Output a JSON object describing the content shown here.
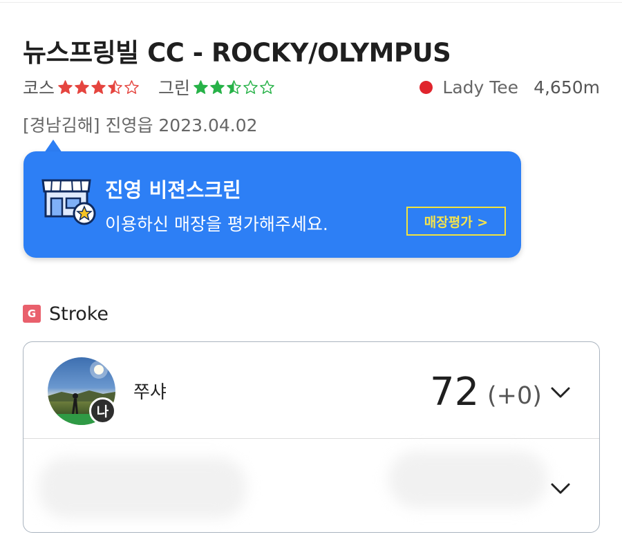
{
  "header": {
    "title": "뉴스프링빌 CC - ROCKY/OLYMPUS",
    "course_label": "코스",
    "course_rating": 3.5,
    "green_label": "그린",
    "green_rating": 2.5,
    "star_colors": {
      "course": "#e5453f",
      "green": "#27b248"
    },
    "tee_color": "#e0242c",
    "tee_name": "Lady Tee",
    "tee_distance": "4,650m",
    "location_date": "[경남김해] 진영읍 2023.04.02"
  },
  "banner": {
    "icon": "store-icon",
    "title": "진영 비젼스크린",
    "subtitle": "이용하신 매장을 평가해주세요.",
    "button_label": "매장평가 >",
    "background": "#2d7ff5",
    "button_color": "#f3e33b"
  },
  "game": {
    "mode_badge": "G",
    "mode_label": "Stroke",
    "players": [
      {
        "me_badge": "나",
        "name": "쭈샤",
        "score": "72",
        "diff": "(+0)"
      }
    ]
  }
}
